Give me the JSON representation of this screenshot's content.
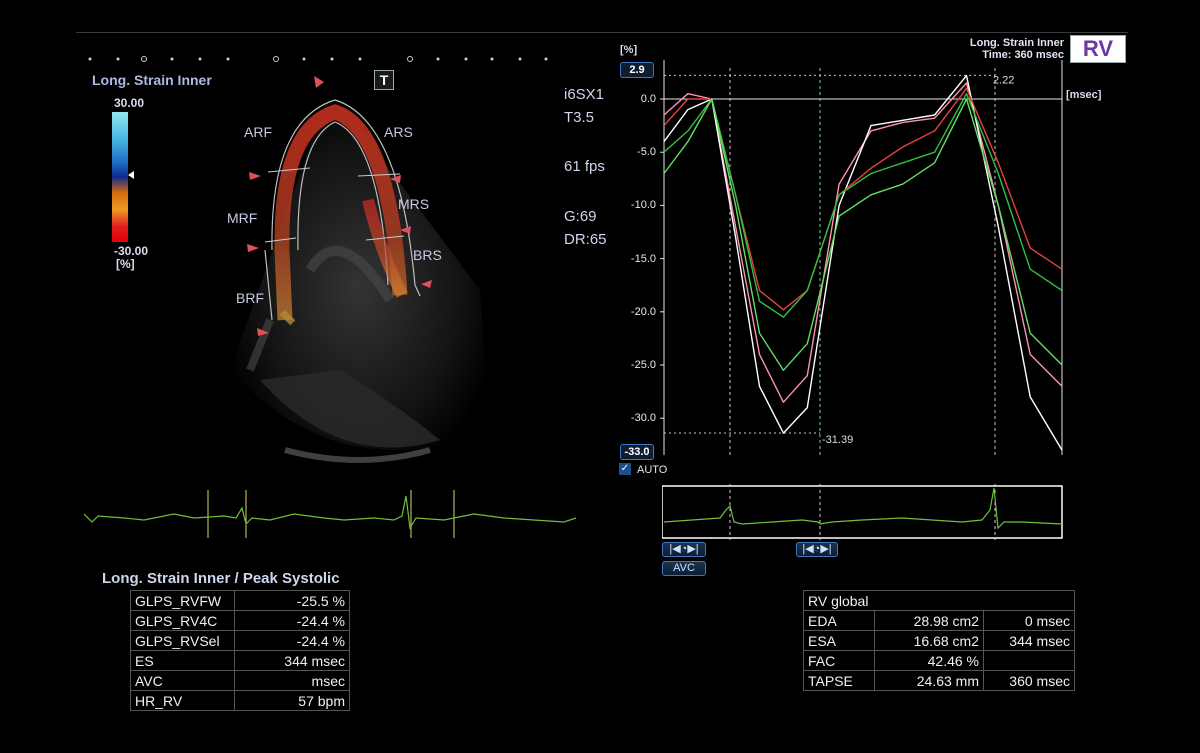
{
  "colorbar": {
    "title": "Long. Strain Inner",
    "max": "30.00",
    "min": "-30.00",
    "unit": "[%]"
  },
  "params": {
    "probe": "i6SX1",
    "freq": "T3.5",
    "fps": "61 fps",
    "gain": "G:69",
    "dr": "DR:65"
  },
  "segments": {
    "arf": "ARF",
    "ars": "ARS",
    "mrf": "MRF",
    "mrs": "MRS",
    "brf": "BRF",
    "brs": "BRS",
    "t_icon": "T"
  },
  "plot_header": {
    "line1": "Long. Strain Inner",
    "line2": "Time: 360 msec",
    "view": "RV"
  },
  "axis": {
    "unit_y": "[%]",
    "unit_x": "[msec]",
    "max_box": "2.9",
    "min_box": "-33.0",
    "ticks": [
      "0.0",
      "-5.0",
      "-10.0",
      "-15.0",
      "-20.0",
      "-25.0",
      "-30.0"
    ],
    "peak_label": "-31.39",
    "top_label": "2.22",
    "auto": "AUTO",
    "avc_btn": "AVC"
  },
  "chart_data": {
    "type": "line",
    "ylabel": "[%]",
    "xlabel": "[msec]",
    "ylim": [
      -33.0,
      2.9
    ],
    "x": [
      0,
      6,
      12,
      18,
      24,
      30,
      36,
      44,
      52,
      60,
      68,
      76,
      84,
      92,
      100
    ],
    "series": [
      {
        "color": "#ff90b0",
        "values": [
          -1.5,
          0.5,
          0.0,
          -12,
          -24,
          -28.5,
          -26,
          -8,
          -3,
          -2.2,
          -1.8,
          1.5,
          -10,
          -24,
          -27
        ]
      },
      {
        "color": "#ffffff",
        "values": [
          -4,
          -1,
          0.0,
          -13,
          -27,
          -31.4,
          -29,
          -10,
          -2.5,
          -2,
          -1.5,
          2.2,
          -12,
          -28,
          -33
        ]
      },
      {
        "color": "#e84040",
        "values": [
          -2.5,
          0.0,
          0.0,
          -9,
          -18,
          -19.8,
          -18,
          -9,
          -6.5,
          -4.5,
          -3,
          1.0,
          -6,
          -14,
          -16
        ]
      },
      {
        "color": "#30c040",
        "values": [
          -5,
          -3,
          0.0,
          -9,
          -19,
          -20.5,
          -18,
          -9,
          -7,
          -6,
          -5,
          0.5,
          -7,
          -16,
          -18
        ]
      },
      {
        "color": "#60e060",
        "values": [
          -7,
          -4,
          0.0,
          -10,
          -22,
          -25.5,
          -23,
          -11,
          -9,
          -8,
          -6,
          0.0,
          -10,
          -22,
          -25
        ]
      }
    ]
  },
  "left_table": {
    "title": "Long. Strain Inner / Peak Systolic",
    "rows": [
      {
        "k": "GLPS_RVFW",
        "v": "-25.5 %"
      },
      {
        "k": "GLPS_RV4C",
        "v": "-24.4 %"
      },
      {
        "k": "GLPS_RVSel",
        "v": "-24.4 %"
      },
      {
        "k": "ES",
        "v": "344 msec"
      },
      {
        "k": "AVC",
        "v": "msec"
      },
      {
        "k": "HR_RV",
        "v": "57 bpm"
      }
    ]
  },
  "right_table": {
    "title": "RV global",
    "rows": [
      {
        "k": "EDA",
        "v": "28.98 cm2",
        "t": "0 msec"
      },
      {
        "k": "ESA",
        "v": "16.68 cm2",
        "t": "344 msec"
      },
      {
        "k": "FAC",
        "v": "42.46 %",
        "t": ""
      },
      {
        "k": "TAPSE",
        "v": "24.63 mm",
        "t": "360 msec"
      }
    ]
  }
}
